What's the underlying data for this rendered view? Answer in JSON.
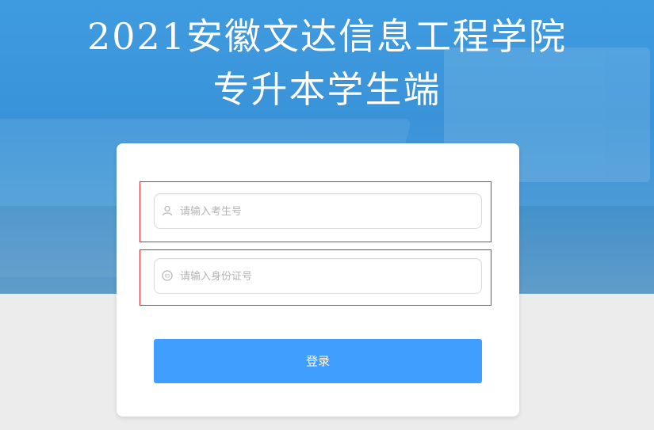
{
  "header": {
    "title_line1": "2021安徽文达信息工程学院",
    "title_line2": "专升本学生端"
  },
  "form": {
    "exam_number": {
      "placeholder": "请输入考生号",
      "value": "",
      "icon": "user-icon"
    },
    "id_number": {
      "placeholder": "请输入身份证号",
      "value": "",
      "icon": "id-icon"
    },
    "login_label": "登录"
  },
  "colors": {
    "hero_blue": "#3f9be0",
    "button_blue": "#409eff",
    "frame_red": "#e0282e",
    "background": "#ececec"
  }
}
